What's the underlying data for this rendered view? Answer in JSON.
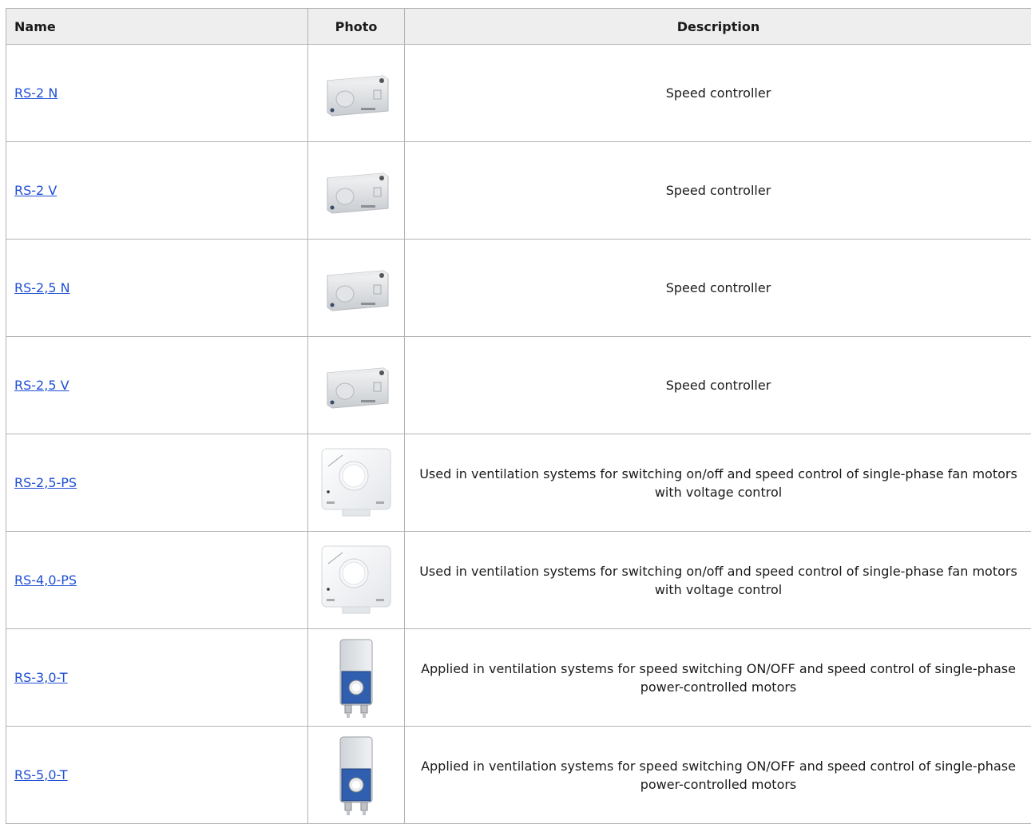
{
  "table": {
    "headers": {
      "name": "Name",
      "photo": "Photo",
      "description": "Description"
    },
    "rows": [
      {
        "name": "RS-2 N",
        "photo": "box-controller-image",
        "description": "Speed controller"
      },
      {
        "name": "RS-2 V",
        "photo": "box-controller-image",
        "description": "Speed controller"
      },
      {
        "name": "RS-2,5 N",
        "photo": "box-controller-image",
        "description": "Speed controller"
      },
      {
        "name": "RS-2,5 V",
        "photo": "box-controller-image",
        "description": "Speed controller"
      },
      {
        "name": "RS-2,5-PS",
        "photo": "square-dial-controller-image",
        "description": "Used in ventilation systems for switching on/off and speed control of single-phase fan motors with voltage control"
      },
      {
        "name": "RS-4,0-PS",
        "photo": "square-dial-controller-image",
        "description": "Used in ventilation systems for switching on/off and speed control of single-phase fan motors with voltage control"
      },
      {
        "name": "RS-3,0-T",
        "photo": "wall-box-controller-image",
        "description": "Applied in ventilation systems for speed switching ON/OFF and speed control of single-phase power-controlled motors"
      },
      {
        "name": "RS-5,0-T",
        "photo": "wall-box-controller-image",
        "description": "Applied in ventilation systems for speed switching ON/OFF and speed control of single-phase power-controlled motors"
      }
    ]
  },
  "colors": {
    "link": "#1f4fd6",
    "header_bg": "#eeeeee",
    "border": "#b3b3b3"
  }
}
